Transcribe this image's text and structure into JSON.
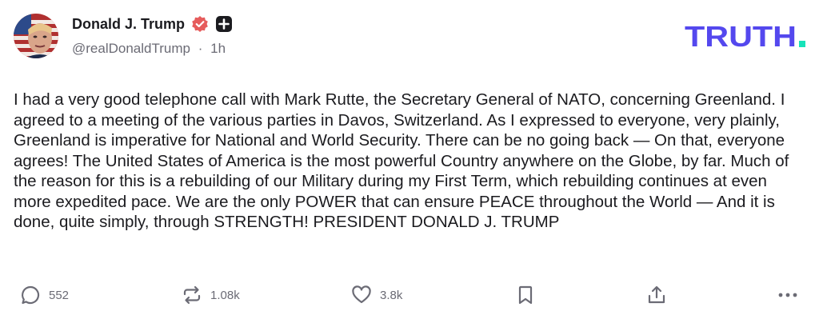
{
  "author": {
    "display_name": "Donald J. Trump",
    "handle": "@realDonaldTrump",
    "separator": "·",
    "time_ago": "1h"
  },
  "brand": {
    "logo_text": "TRUTH.",
    "logo_color": "#5448ee",
    "logo_dot_color": "#17e3b9",
    "verified_badge_color": "#e65c5c"
  },
  "post": {
    "text": "I had a very good telephone call with Mark Rutte, the Secretary General of NATO, concerning Greenland. I agreed to a meeting of the various parties in Davos, Switzerland. As I expressed to everyone, very plainly, Greenland is imperative for National and World Security. There can be no going back — On that, everyone agrees! The United States of America is the most powerful Country anywhere on the Globe, by far. Much of the reason for this is a rebuilding of our Military during my First Term, which rebuilding continues at even more expedited pace. We are the only POWER that can ensure PEACE throughout the World — And it is done, quite simply, through STRENGTH! PRESIDENT DONALD J. TRUMP"
  },
  "actions": {
    "replies_count": "552",
    "retruths_count": "1.08k",
    "likes_count": "3.8k",
    "icons": [
      "reply-icon",
      "retruth-icon",
      "like-icon",
      "bookmark-icon",
      "share-icon",
      "more-icon"
    ]
  }
}
